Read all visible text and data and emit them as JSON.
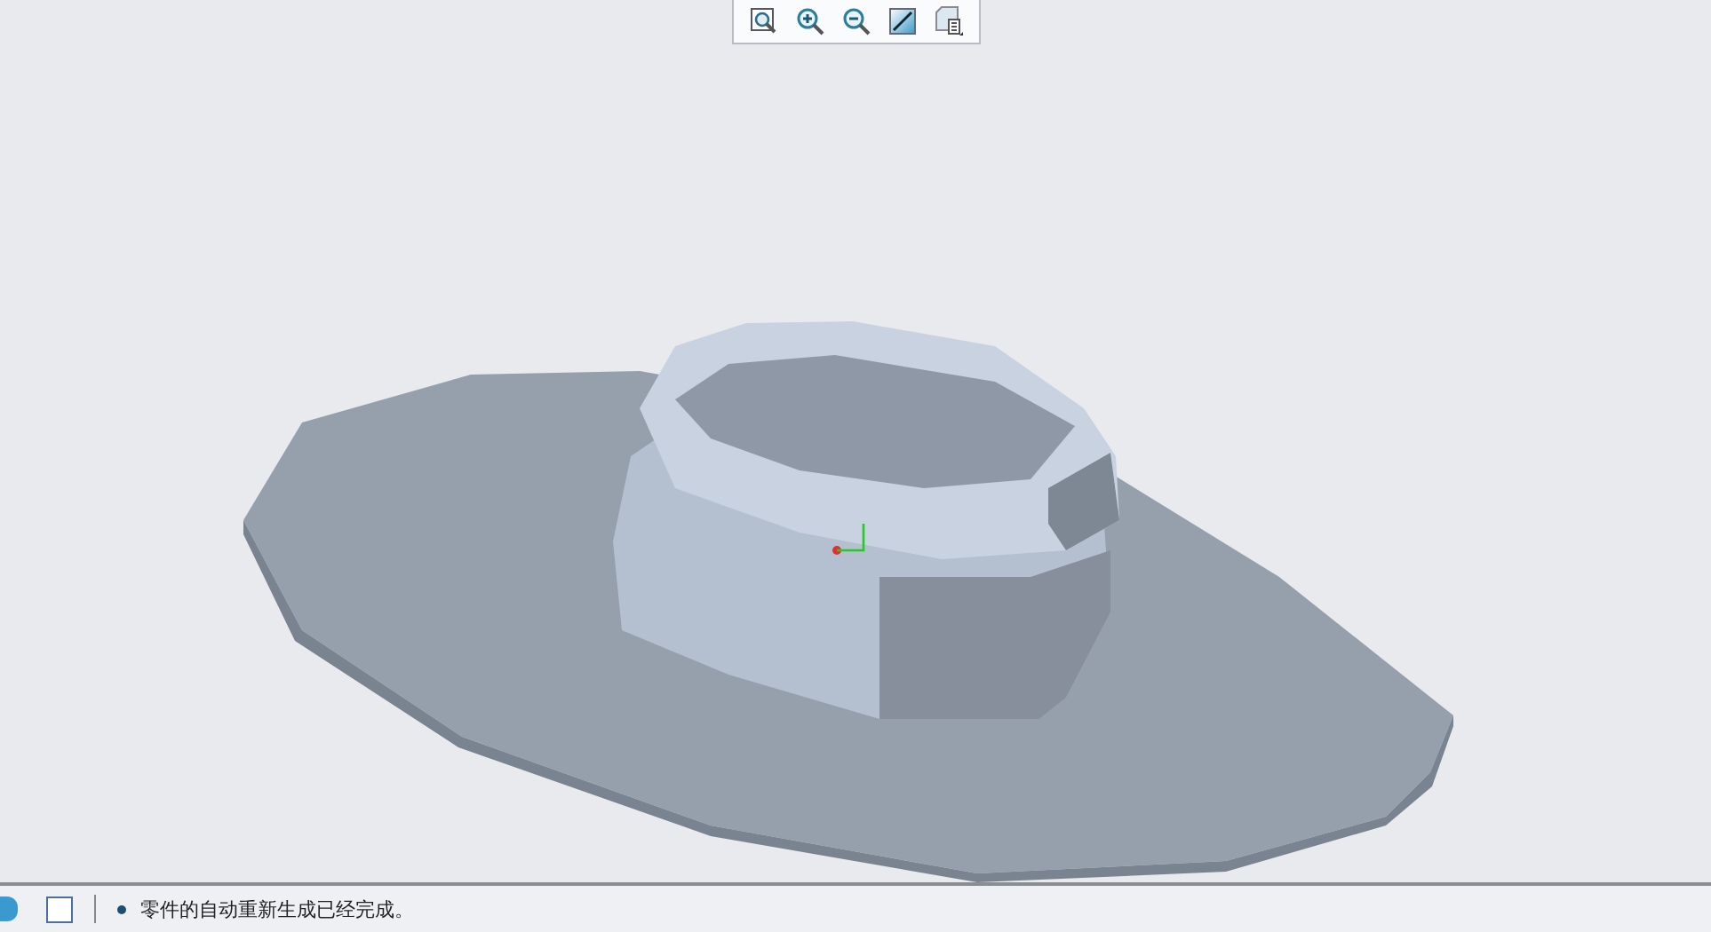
{
  "status_bar": {
    "message": "零件的自动重新生成已经完成。"
  }
}
